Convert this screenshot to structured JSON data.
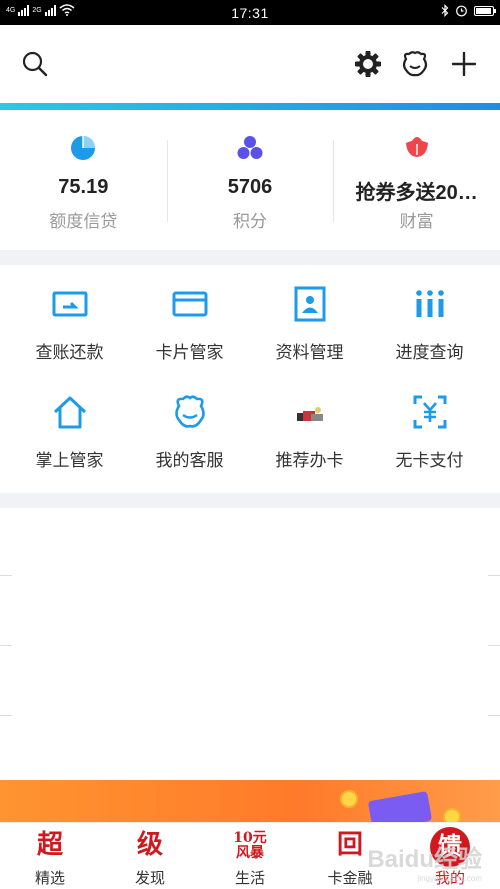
{
  "status_bar": {
    "network_1": "4G",
    "network_2": "2G",
    "time": "17:31"
  },
  "top_bar": {
    "icons": [
      "search-icon",
      "settings-icon",
      "customer-service-icon",
      "add-icon"
    ]
  },
  "stats": [
    {
      "value": "75.19",
      "label": "额度信贷",
      "icon": "pie-chart-icon",
      "color": "#1e9be8"
    },
    {
      "value": "5706",
      "label": "积分",
      "icon": "three-dots-icon",
      "color": "#5a52e8"
    },
    {
      "value": "抢券多送20…",
      "label": "财富",
      "icon": "lotus-icon",
      "color": "#f0454a"
    }
  ],
  "services": [
    {
      "label": "查账还款",
      "icon": "bill-repay-icon"
    },
    {
      "label": "卡片管家",
      "icon": "card-icon"
    },
    {
      "label": "资料管理",
      "icon": "profile-icon"
    },
    {
      "label": "进度查询",
      "icon": "progress-icon"
    },
    {
      "label": "掌上管家",
      "icon": "home-icon"
    },
    {
      "label": "我的客服",
      "icon": "service-icon"
    },
    {
      "label": "推荐办卡",
      "icon": "recommend-card-icon"
    },
    {
      "label": "无卡支付",
      "icon": "cardless-pay-icon"
    }
  ],
  "tabs": [
    {
      "glyph": "超",
      "label": "精选"
    },
    {
      "glyph": "级",
      "label": "发现"
    },
    {
      "glyph": "10元 风暴",
      "label": "生活"
    },
    {
      "glyph": "回",
      "label": "卡金融"
    },
    {
      "glyph": "馈",
      "label": "我的",
      "active": true
    }
  ],
  "watermark": {
    "text": "Baidu经验",
    "sub": "jingyan.baidu.com"
  },
  "accent": "#1e9be8",
  "brand_red": "#d0191f"
}
